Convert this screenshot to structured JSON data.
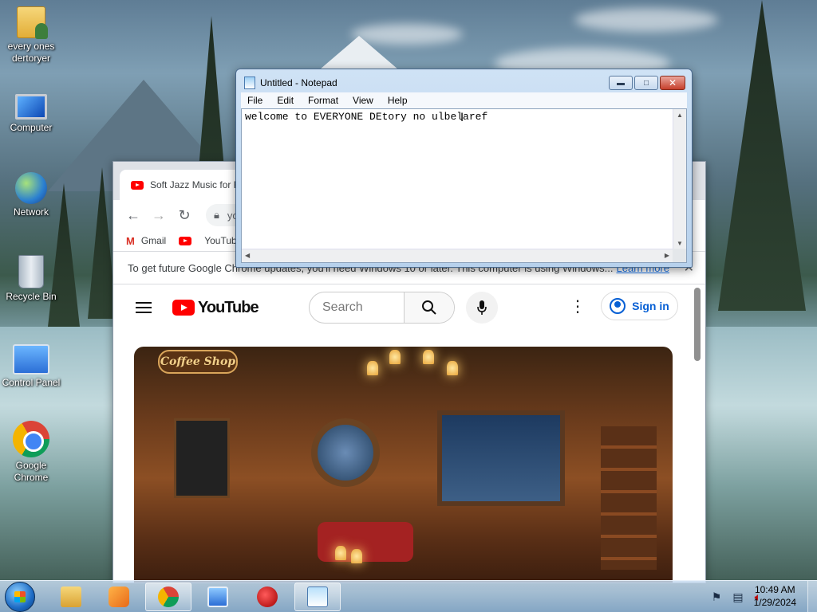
{
  "desktop": {
    "icons": [
      {
        "label": "every ones dertoryer",
        "icon": "folder-icon"
      },
      {
        "label": "Computer",
        "icon": "computer-icon"
      },
      {
        "label": "Network",
        "icon": "network-icon"
      },
      {
        "label": "Recycle Bin",
        "icon": "recycle-bin-icon"
      },
      {
        "label": "Control Panel",
        "icon": "control-panel-icon"
      },
      {
        "label": "Google Chrome",
        "icon": "chrome-icon"
      }
    ]
  },
  "chrome": {
    "tab_title": "Soft Jazz Music for R",
    "address_partial": "yo",
    "bookmarks": [
      "Gmail",
      "YouTube"
    ],
    "infobar": {
      "message": "To get future Google Chrome updates, you'll need Windows 10 or later. This computer is using Windows...",
      "link": "Learn more"
    },
    "youtube": {
      "logo_text": "YouTube",
      "search_placeholder": "Search",
      "sign_in": "Sign in",
      "thumbnail_sign": "Coffee Shop"
    }
  },
  "notepad": {
    "title": "Untitled - Notepad",
    "menu": [
      "File",
      "Edit",
      "Format",
      "View",
      "Help"
    ],
    "content": "welcome to EVERYONE DEtory no ulbelaref"
  },
  "taskbar": {
    "apps": [
      {
        "name": "explorer",
        "icon": "explorer-icon",
        "active": false
      },
      {
        "name": "media-player",
        "icon": "media-player-icon",
        "active": false
      },
      {
        "name": "chrome",
        "icon": "chrome-icon",
        "active": true
      },
      {
        "name": "control-panel",
        "icon": "control-panel-icon",
        "active": false
      },
      {
        "name": "red-app",
        "icon": "red-app-icon",
        "active": false
      },
      {
        "name": "notepad",
        "icon": "notepad-icon",
        "active": true
      }
    ],
    "clock_time": "10:49 AM",
    "clock_date": "1/29/2024"
  },
  "colors": {
    "youtube_red": "#ff0000",
    "link_blue": "#1a73e8",
    "signin_blue": "#065fd4",
    "notepad_close_red": "#c7402c"
  }
}
